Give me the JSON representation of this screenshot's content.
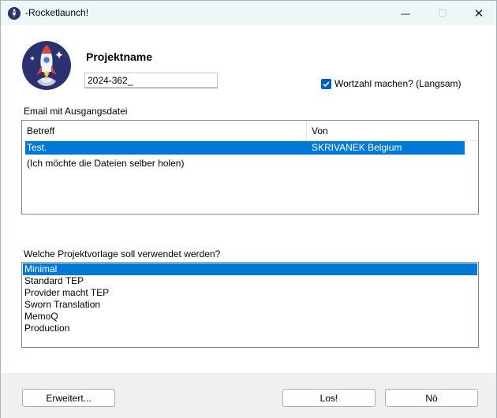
{
  "window": {
    "title": "-Rocketlaunch!",
    "min_glyph": "—",
    "max_glyph": "☐",
    "close_glyph": "✕"
  },
  "project": {
    "label": "Projektname",
    "value": "2024-362_"
  },
  "wordcount": {
    "label": "Wortzahl machen? (Langsam)",
    "checked": true
  },
  "email": {
    "label": "Email mit Ausgangsdatei",
    "columns": [
      "Betreff",
      "Von"
    ],
    "rows": [
      {
        "subject": "Test.",
        "from": "SKRIVANEK Belgium",
        "selected": true
      },
      {
        "subject": "(Ich möchte die Dateien selber holen)",
        "from": "",
        "selected": false
      }
    ]
  },
  "template": {
    "label": "Welche Projektvorlage soll verwendet werden?",
    "options": [
      "Minimal",
      "Standard TEP",
      "Provider macht TEP",
      "Sworn Translation",
      "MemoQ",
      "Production"
    ],
    "selected_index": 0
  },
  "buttons": {
    "advanced": "Erweitert...",
    "go": "Los!",
    "no": "Nö"
  },
  "colors": {
    "accent": "#0078d7",
    "checkbox": "#005fb8",
    "logo_bg": "#2b3270"
  }
}
